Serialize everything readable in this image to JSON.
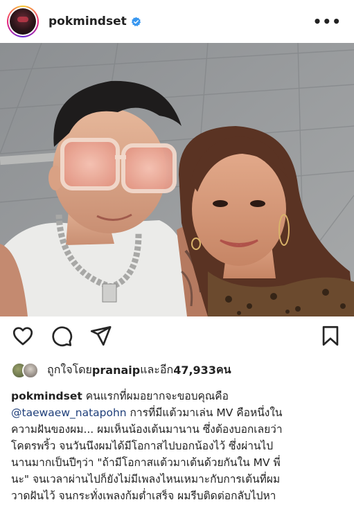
{
  "header": {
    "username": "pokmindset",
    "verified_icon": "verified-badge-icon",
    "more_icon": "more-options-icon"
  },
  "post": {
    "image_alt_icon": "photo"
  },
  "actions": {
    "like_icon": "heart-icon",
    "comment_icon": "comment-icon",
    "share_icon": "send-icon",
    "save_icon": "bookmark-icon"
  },
  "likes": {
    "prefix": "ถูกใจโดย ",
    "user": "pranaip",
    "middle": " และอีก ",
    "count": "47,933",
    "suffix": " คน"
  },
  "caption": {
    "author": "pokmindset",
    "line1_rest": " คนแรกที่ผมอยากจะขอบคุณคือ",
    "mention": "@taewaew_natapohn",
    "line2_rest": " การที่มีแต้วมาเล่น MV คือหนึ่งใน",
    "line3": "ความฝันของผม... ผมเห็นน้องเต้นมานาน ซึ่งต้องบอกเลยว่า",
    "line4": "โคตรพริ้ว จนวันนึงผมได้มีโอกาสไปบอกน้องไว้ ซึ่งผ่านไป",
    "line5": "นานมากเป็นปีๆว่า \"ถ้ามีโอกาสแต้วมาเต้นด้วยกันใน MV พี่",
    "line6": "นะ\" จนเวลาผ่านไปก็ยังไม่มีเพลงไหนเหมาะกับการเต้นที่ผม",
    "line7": "วาดฝันไว้ จนกระทั่งเพลงก้มต่ำเสร็จ ผมรีบติดต่อกลับไปหา"
  },
  "colors": {
    "verified": "#3897f0",
    "text": "#222222",
    "mention": "#1f3f7a"
  }
}
